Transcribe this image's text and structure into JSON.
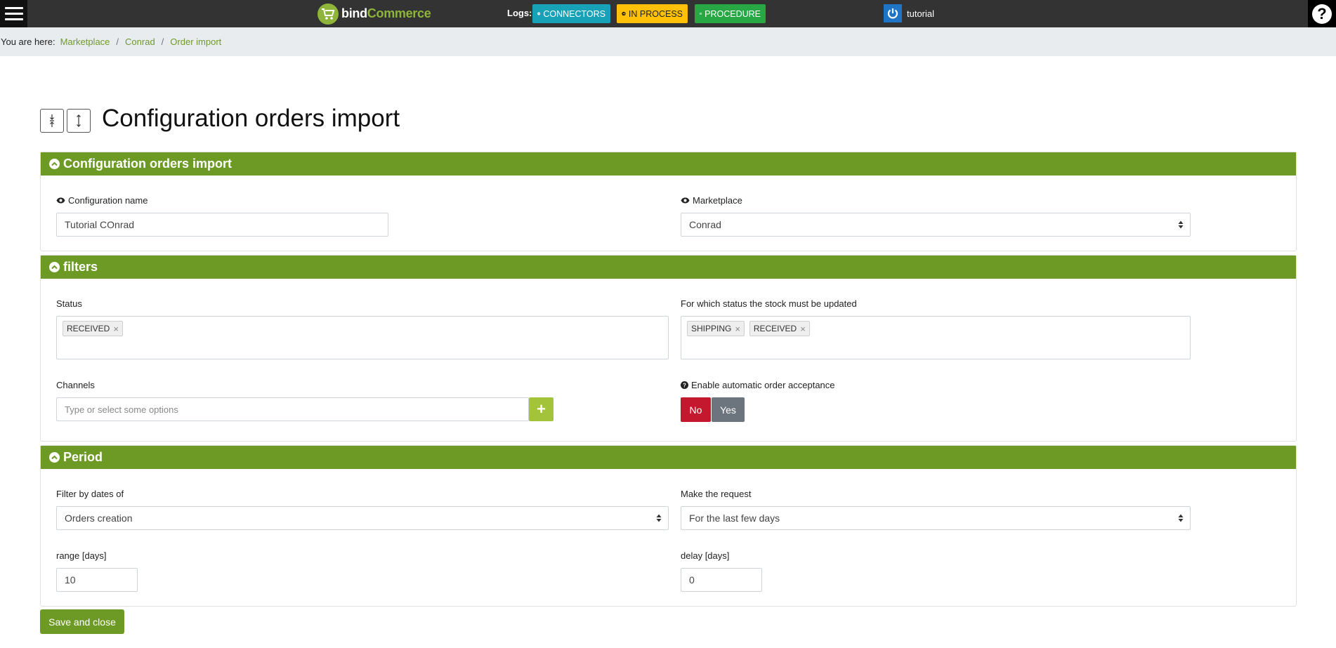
{
  "topbar": {
    "logo_part1": "bind",
    "logo_part2": "Commerce",
    "logs_label": "Logs:",
    "connectors_label": "CONNECTORS",
    "in_process_label": "IN PROCESS",
    "procedure_label": "PROCEDURE",
    "username": "tutorial",
    "help_label": "?"
  },
  "breadcrumb": {
    "prefix": "You are here:",
    "items": [
      "Marketplace",
      "Conrad",
      "Order import"
    ]
  },
  "page": {
    "title": "Configuration orders import"
  },
  "sections": {
    "config": {
      "header": "Configuration orders import",
      "name_label": "Configuration name",
      "name_value": "Tutorial COnrad",
      "marketplace_label": "Marketplace",
      "marketplace_value": "Conrad"
    },
    "filters": {
      "header": "filters",
      "status_label": "Status",
      "status_tags": [
        "RECEIVED"
      ],
      "stock_label": "For which status the stock must be updated",
      "stock_tags": [
        "SHIPPING",
        "RECEIVED"
      ],
      "channels_label": "Channels",
      "channels_placeholder": "Type or select some options",
      "auto_accept_label": "Enable automatic order acceptance",
      "no_label": "No",
      "yes_label": "Yes"
    },
    "period": {
      "header": "Period",
      "filter_dates_label": "Filter by dates of",
      "filter_dates_value": "Orders creation",
      "request_label": "Make the request",
      "request_value": "For the last few days",
      "range_label": "range [days]",
      "range_value": "10",
      "delay_label": "delay [days]",
      "delay_value": "0"
    }
  },
  "footer": {
    "save_label": "Save and close"
  },
  "colors": {
    "primary_green": "#6d9a24",
    "topbar": "#333333",
    "connectors": "#17a2b8",
    "in_process": "#ffc107",
    "procedure": "#28a745",
    "no_button": "#c3182d",
    "yes_button": "#6c757d"
  }
}
